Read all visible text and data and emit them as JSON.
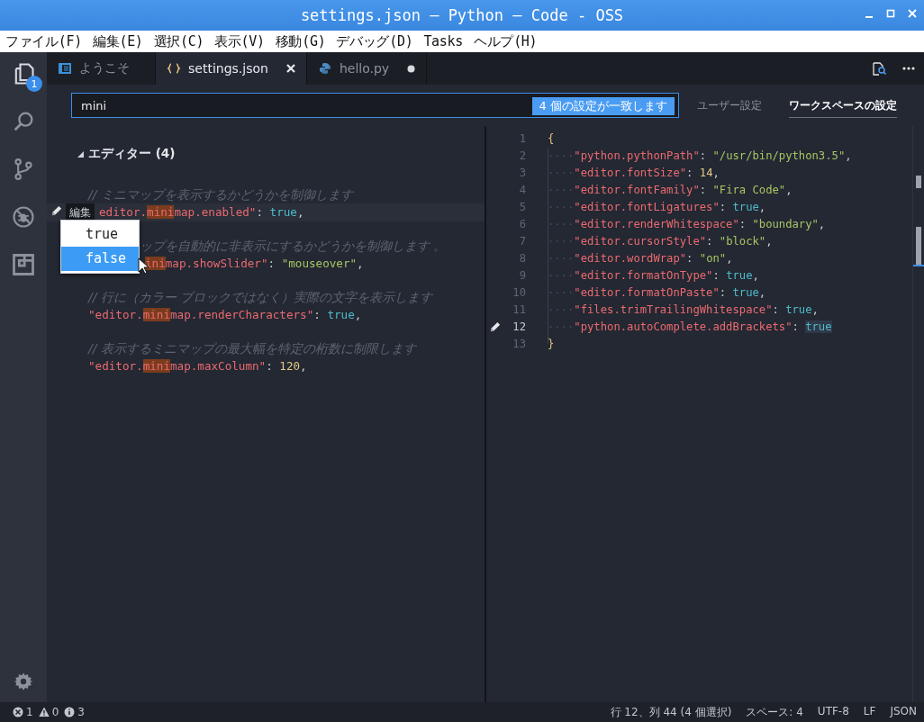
{
  "window": {
    "title": "settings.json — Python — Code - OSS"
  },
  "menu": [
    "ファイル(F)",
    "編集(E)",
    "選択(C)",
    "表示(V)",
    "移動(G)",
    "デバッグ(D)",
    "Tasks",
    "ヘルプ(H)"
  ],
  "activity_bar": [
    {
      "kind": "files",
      "selected": true,
      "badge": "1"
    },
    {
      "kind": "search",
      "selected": false
    },
    {
      "kind": "source-control",
      "selected": false
    },
    {
      "kind": "debug",
      "selected": false
    },
    {
      "kind": "extensions",
      "selected": false
    }
  ],
  "tabs": [
    {
      "label": "ようこそ",
      "kind": "welcome",
      "selected": false,
      "dirty": false
    },
    {
      "label": "settings.json",
      "kind": "json",
      "selected": true,
      "dirty": false
    },
    {
      "label": "hello.py",
      "kind": "python",
      "selected": false,
      "dirty": true
    }
  ],
  "settings_header": {
    "search": {
      "value": "mini",
      "match_count": "4 個の設定が一致します"
    },
    "targets": [
      {
        "label": "ユーザー設定",
        "selected": false
      },
      {
        "label": "ワークスペースの設定",
        "selected": true
      }
    ]
  },
  "default_settings": {
    "group": {
      "title": "エディター (4)",
      "expanded": true
    },
    "edit_menu": {
      "label": "編集",
      "options": [
        {
          "label": "true",
          "selected": false
        },
        {
          "label": "false",
          "selected": true
        }
      ]
    },
    "entries": [
      {
        "comment": "// ミニマップを表示するかどうかを制御します",
        "editing": true,
        "covered": false,
        "code": [
          {
            "text": "editor.",
            "kind": "key"
          },
          {
            "text": "mini",
            "kind": "match"
          },
          {
            "text": "map.enabled\"",
            "kind": "key"
          },
          {
            "text": ": ",
            "kind": "punct"
          },
          {
            "text": "true",
            "kind": "boolean"
          },
          {
            "text": ",",
            "kind": "punct"
          }
        ]
      },
      {
        "comment": "ップを自動的に非表示にするかどうかを制御します 。",
        "editing": false,
        "covered": true,
        "code": [
          {
            "text": "ini",
            "kind": "match"
          },
          {
            "text": "map.showSlider\"",
            "kind": "key"
          },
          {
            "text": ": ",
            "kind": "punct"
          },
          {
            "text": "\"mouseover\"",
            "kind": "string"
          },
          {
            "text": ",",
            "kind": "punct"
          }
        ]
      },
      {
        "comment": "// 行に（カラー ブロックではなく）実際の文字を表示します",
        "editing": false,
        "covered": false,
        "code": [
          {
            "text": "\"editor.",
            "kind": "key"
          },
          {
            "text": "mini",
            "kind": "match"
          },
          {
            "text": "map.renderCharacters\"",
            "kind": "key"
          },
          {
            "text": ": ",
            "kind": "punct"
          },
          {
            "text": "true",
            "kind": "boolean"
          },
          {
            "text": ",",
            "kind": "punct"
          }
        ]
      },
      {
        "comment": "// 表示するミニマップの最大幅を特定の桁数に制限します",
        "editing": false,
        "covered": false,
        "code": [
          {
            "text": "\"editor.",
            "kind": "key"
          },
          {
            "text": "mini",
            "kind": "match"
          },
          {
            "text": "map.maxColumn\"",
            "kind": "key"
          },
          {
            "text": ": ",
            "kind": "punct"
          },
          {
            "text": "120",
            "kind": "number"
          },
          {
            "text": ",",
            "kind": "punct"
          }
        ]
      }
    ]
  },
  "workspace_settings": {
    "lines": [
      {
        "number": "1",
        "edit_marker": false,
        "tokens": [
          {
            "text": "{",
            "kind": "brace"
          }
        ]
      },
      {
        "number": "2",
        "edit_marker": false,
        "tokens": [
          {
            "text": "····",
            "kind": "whitespace"
          },
          {
            "text": "\"python.pythonPath\"",
            "kind": "key"
          },
          {
            "text": ": ",
            "kind": "punct"
          },
          {
            "text": "\"/usr/bin/python3.5\"",
            "kind": "string"
          },
          {
            "text": ",",
            "kind": "punct"
          }
        ]
      },
      {
        "number": "3",
        "edit_marker": false,
        "tokens": [
          {
            "text": "····",
            "kind": "whitespace"
          },
          {
            "text": "\"editor.fontSize\"",
            "kind": "key"
          },
          {
            "text": ": ",
            "kind": "punct"
          },
          {
            "text": "14",
            "kind": "number"
          },
          {
            "text": ",",
            "kind": "punct"
          }
        ]
      },
      {
        "number": "4",
        "edit_marker": false,
        "tokens": [
          {
            "text": "····",
            "kind": "whitespace"
          },
          {
            "text": "\"editor.fontFamily\"",
            "kind": "key"
          },
          {
            "text": ": ",
            "kind": "punct"
          },
          {
            "text": "\"Fira Code\"",
            "kind": "string"
          },
          {
            "text": ",",
            "kind": "punct"
          }
        ]
      },
      {
        "number": "5",
        "edit_marker": false,
        "tokens": [
          {
            "text": "····",
            "kind": "whitespace"
          },
          {
            "text": "\"editor.fontLigatures\"",
            "kind": "key"
          },
          {
            "text": ": ",
            "kind": "punct"
          },
          {
            "text": "true",
            "kind": "boolean"
          },
          {
            "text": ",",
            "kind": "punct"
          }
        ]
      },
      {
        "number": "6",
        "edit_marker": false,
        "tokens": [
          {
            "text": "····",
            "kind": "whitespace"
          },
          {
            "text": "\"editor.renderWhitespace\"",
            "kind": "key"
          },
          {
            "text": ": ",
            "kind": "punct"
          },
          {
            "text": "\"boundary\"",
            "kind": "string"
          },
          {
            "text": ",",
            "kind": "punct"
          }
        ]
      },
      {
        "number": "7",
        "edit_marker": false,
        "tokens": [
          {
            "text": "····",
            "kind": "whitespace"
          },
          {
            "text": "\"editor.cursorStyle\"",
            "kind": "key"
          },
          {
            "text": ": ",
            "kind": "punct"
          },
          {
            "text": "\"block\"",
            "kind": "string"
          },
          {
            "text": ",",
            "kind": "punct"
          }
        ]
      },
      {
        "number": "8",
        "edit_marker": false,
        "tokens": [
          {
            "text": "····",
            "kind": "whitespace"
          },
          {
            "text": "\"editor.wordWrap\"",
            "kind": "key"
          },
          {
            "text": ": ",
            "kind": "punct"
          },
          {
            "text": "\"on\"",
            "kind": "string"
          },
          {
            "text": ",",
            "kind": "punct"
          }
        ]
      },
      {
        "number": "9",
        "edit_marker": false,
        "tokens": [
          {
            "text": "····",
            "kind": "whitespace"
          },
          {
            "text": "\"editor.formatOnType\"",
            "kind": "key"
          },
          {
            "text": ": ",
            "kind": "punct"
          },
          {
            "text": "true",
            "kind": "boolean"
          },
          {
            "text": ",",
            "kind": "punct"
          }
        ]
      },
      {
        "number": "10",
        "edit_marker": false,
        "tokens": [
          {
            "text": "····",
            "kind": "whitespace"
          },
          {
            "text": "\"editor.formatOnPaste\"",
            "kind": "key"
          },
          {
            "text": ": ",
            "kind": "punct"
          },
          {
            "text": "true",
            "kind": "boolean"
          },
          {
            "text": ",",
            "kind": "punct"
          }
        ]
      },
      {
        "number": "11",
        "edit_marker": false,
        "tokens": [
          {
            "text": "····",
            "kind": "whitespace"
          },
          {
            "text": "\"files.trimTrailingWhitespace\"",
            "kind": "key"
          },
          {
            "text": ": ",
            "kind": "punct"
          },
          {
            "text": "true",
            "kind": "boolean"
          },
          {
            "text": ",",
            "kind": "punct"
          }
        ]
      },
      {
        "number": "12",
        "edit_marker": true,
        "tokens": [
          {
            "text": "····",
            "kind": "whitespace"
          },
          {
            "text": "\"python.autoComplete.addBrackets\"",
            "kind": "key"
          },
          {
            "text": ": ",
            "kind": "punct"
          },
          {
            "text": "true",
            "kind": "selection"
          }
        ]
      },
      {
        "number": "13",
        "edit_marker": false,
        "tokens": [
          {
            "text": "}",
            "kind": "brace"
          }
        ]
      }
    ]
  },
  "status_bar": {
    "problems": [
      {
        "kind": "error",
        "count": "1"
      },
      {
        "kind": "warning",
        "count": "0"
      },
      {
        "kind": "info",
        "count": "3"
      }
    ],
    "items": [
      "行 12、列 44 (4 個選択)",
      "スペース: 4",
      "UTF-8",
      "LF",
      "JSON"
    ]
  }
}
